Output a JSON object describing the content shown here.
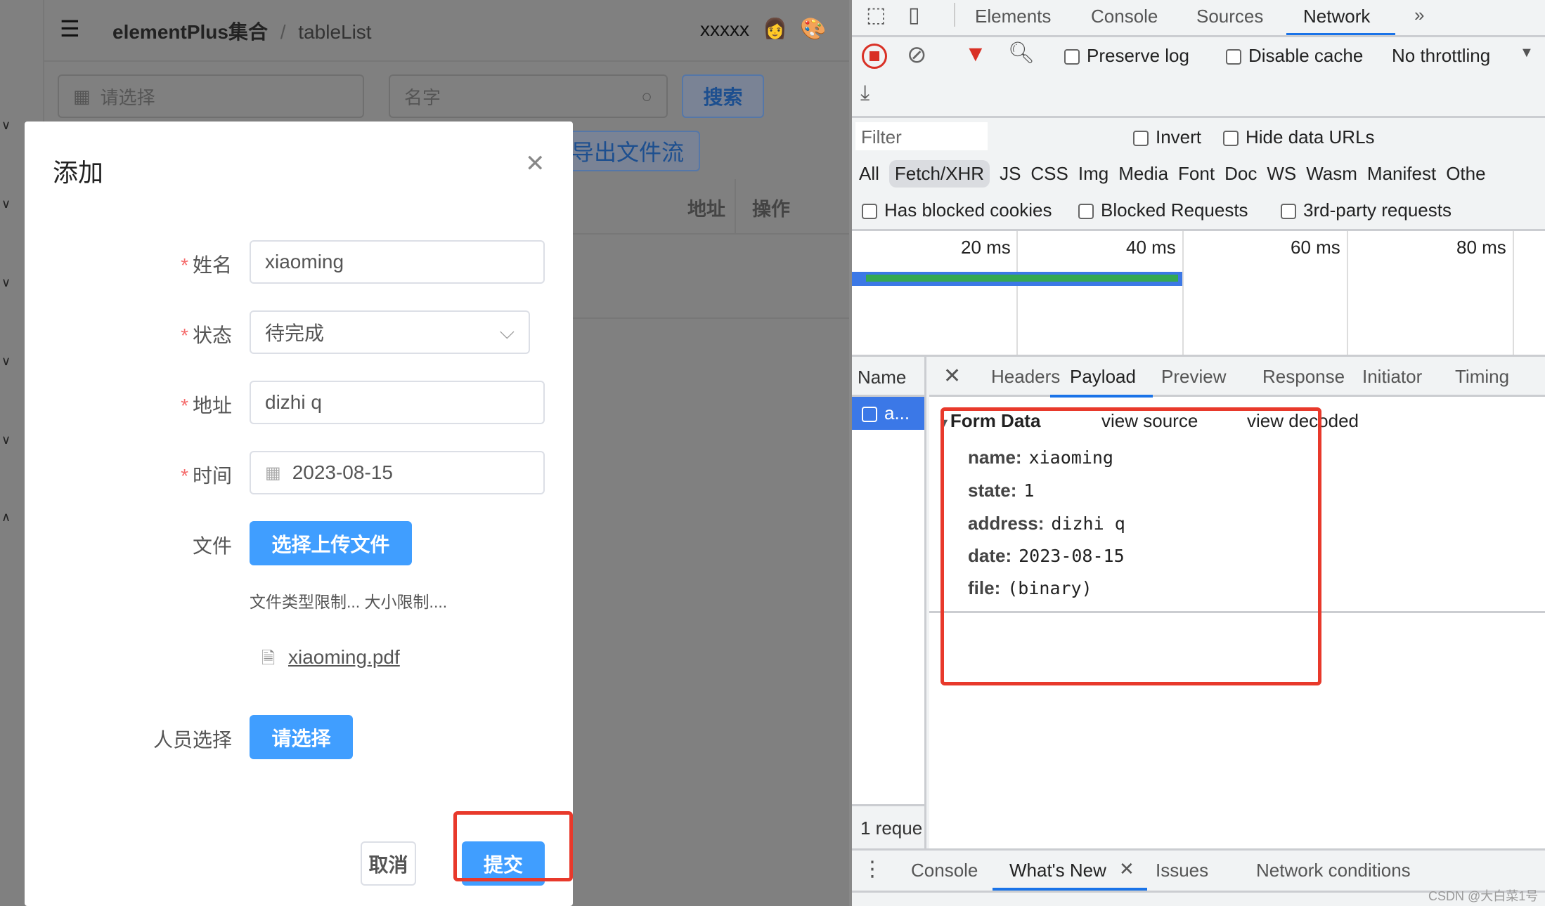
{
  "app": {
    "breadcrumb": {
      "root": "elementPlus集合",
      "sep": "/",
      "current": "tableList"
    },
    "user": "xxxxx",
    "search": {
      "date_placeholder": "请选择",
      "name_placeholder": "名字",
      "search_label": "搜索"
    },
    "export_label": "导出文件流",
    "table_headers": [
      "地址",
      "操作"
    ]
  },
  "dialog": {
    "title": "添加",
    "fields": [
      {
        "label": "姓名",
        "value": "xiaoming",
        "required": true
      },
      {
        "label": "状态",
        "value": "待完成",
        "required": true
      },
      {
        "label": "地址",
        "value": "dizhi q",
        "required": true
      },
      {
        "label": "时间",
        "value": "2023-08-15",
        "required": true
      }
    ],
    "file_label": "文件",
    "upload_label": "选择上传文件",
    "hint": "文件类型限制... 大小限制....",
    "file_name": "xiaoming.pdf",
    "person_label": "人员选择",
    "person_button": "请选择",
    "cancel": "取消",
    "submit": "提交",
    "highlight_color": "#e8392b"
  },
  "devtools": {
    "tabs": [
      "Elements",
      "Console",
      "Sources",
      "Network"
    ],
    "active_tab": "Network",
    "toolbar": {
      "preserve_log": "Preserve log",
      "disable_cache": "Disable cache",
      "throttling": "No throttling"
    },
    "filter_placeholder": "Filter",
    "invert": "Invert",
    "hide_data_urls": "Hide data URLs",
    "types": [
      "All",
      "Fetch/XHR",
      "JS",
      "CSS",
      "Img",
      "Media",
      "Font",
      "Doc",
      "WS",
      "Wasm",
      "Manifest",
      "Othe"
    ],
    "active_type": "Fetch/XHR",
    "blocked": [
      "Has blocked cookies",
      "Blocked Requests",
      "3rd-party requests"
    ],
    "timeline_ticks": [
      "20 ms",
      "40 ms",
      "60 ms",
      "80 ms"
    ],
    "name_header": "Name",
    "request_name": "a...",
    "status": "1 reque",
    "detail_tabs": [
      "Headers",
      "Payload",
      "Preview",
      "Response",
      "Initiator",
      "Timing"
    ],
    "active_detail": "Payload",
    "form_data": {
      "title": "Form Data",
      "view_source": "view source",
      "view_decoded": "view decoded",
      "rows": [
        {
          "k": "name:",
          "v": "xiaoming"
        },
        {
          "k": "state:",
          "v": "1"
        },
        {
          "k": "address:",
          "v": "dizhi q"
        },
        {
          "k": "date:",
          "v": "2023-08-15"
        },
        {
          "k": "file:",
          "v": "(binary)"
        }
      ]
    },
    "drawer_tabs": [
      "Console",
      "What's New",
      "Issues",
      "Network conditions"
    ],
    "active_drawer": "What's New",
    "accent": "#1a73e8"
  },
  "watermark": "CSDN @大白菜1号"
}
